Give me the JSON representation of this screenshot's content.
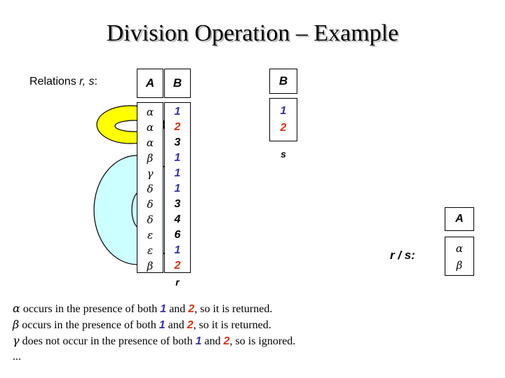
{
  "slide": {
    "title": "Division Operation – Example",
    "relations_label_plain": "Relations ",
    "relations_label_italic": "r, s",
    "relations_label_colon": ":"
  },
  "colors": {
    "blue": "#3333AA",
    "orange": "#DD3311",
    "black": "#000000",
    "yellow_shape": "#FFFF00",
    "cyan_shape": "#CCFFFF",
    "shape_outline": "#000000",
    "title_shadow": "#B8B8B8"
  },
  "relation_r": {
    "caption": "r",
    "headers": [
      "A",
      "B"
    ],
    "rows": [
      {
        "a": "α",
        "b": "1",
        "b_color": "blue"
      },
      {
        "a": "α",
        "b": "2",
        "b_color": "orange"
      },
      {
        "a": "α",
        "b": "3",
        "b_color": "black"
      },
      {
        "a": "β",
        "b": "1",
        "b_color": "blue"
      },
      {
        "a": "γ",
        "b": "1",
        "b_color": "blue"
      },
      {
        "a": "δ",
        "b": "1",
        "b_color": "blue"
      },
      {
        "a": "δ",
        "b": "3",
        "b_color": "black"
      },
      {
        "a": "δ",
        "b": "4",
        "b_color": "black"
      },
      {
        "a": "ε",
        "b": "6",
        "b_color": "black"
      },
      {
        "a": "ε",
        "b": "1",
        "b_color": "blue"
      },
      {
        "a": "β",
        "b": "2",
        "b_color": "orange"
      }
    ]
  },
  "relation_s": {
    "caption": "s",
    "header": "B",
    "rows": [
      {
        "b": "1",
        "b_color": "blue"
      },
      {
        "b": "2",
        "b_color": "orange"
      }
    ]
  },
  "result": {
    "label": "r / s:",
    "header": "A",
    "rows": [
      {
        "a": "α"
      },
      {
        "a": "β"
      }
    ]
  },
  "explanation": {
    "lines": [
      {
        "greek": "α",
        "part1": " occurs in the presence of both ",
        "num1": "1",
        "part2": " and ",
        "num2": "2",
        "part3": ", so it is returned."
      },
      {
        "greek": "β",
        "part1": " occurs in the presence of both ",
        "num1": "1",
        "part2": " and ",
        "num2": "2",
        "part3": ", so it is returned."
      },
      {
        "greek": "γ",
        "part1": " does not occur in the presence of both ",
        "num1": "1",
        "part2": " and ",
        "num2": "2",
        "part3": ", so is ignored."
      }
    ],
    "ellipsis": "..."
  }
}
